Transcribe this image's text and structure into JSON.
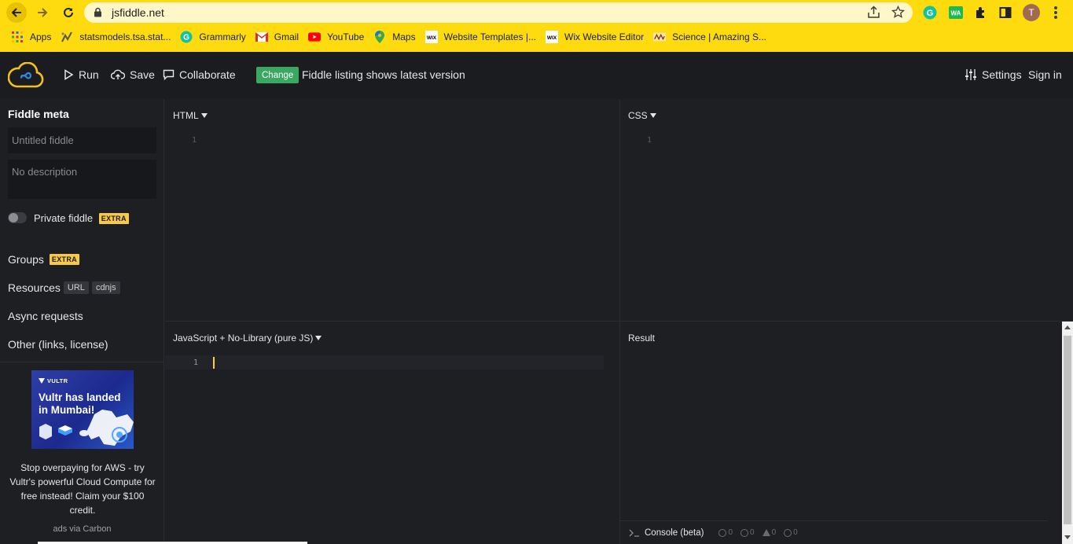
{
  "browser": {
    "url": "jsfiddle.net",
    "avatar_initial": "T",
    "bookmarks": [
      {
        "label": "Apps",
        "icon": "apps-grid-icon"
      },
      {
        "label": "statsmodels.tsa.stat...",
        "icon": "statsmodels-icon"
      },
      {
        "label": "Grammarly",
        "icon": "grammarly-icon"
      },
      {
        "label": "Gmail",
        "icon": "gmail-icon"
      },
      {
        "label": "YouTube",
        "icon": "youtube-icon"
      },
      {
        "label": "Maps",
        "icon": "maps-icon"
      },
      {
        "label": "Website Templates |...",
        "icon": "wix-icon"
      },
      {
        "label": "Wix Website Editor",
        "icon": "wix-icon"
      },
      {
        "label": "Science | Amazing S...",
        "icon": "science-icon"
      }
    ],
    "extension_wa": "WA"
  },
  "header": {
    "run_label": "Run",
    "save_label": "Save",
    "collaborate_label": "Collaborate",
    "change_label": "Change",
    "listing_text": "Fiddle listing shows latest version",
    "settings_label": "Settings",
    "signin_label": "Sign in"
  },
  "sidebar": {
    "meta_title": "Fiddle meta",
    "title_placeholder": "Untitled fiddle",
    "description_placeholder": "No description",
    "private_label": "Private fiddle",
    "extra_badge": "EXTRA",
    "groups_label": "Groups",
    "resources_label": "Resources",
    "resource_tags": [
      "URL",
      "cdnjs"
    ],
    "async_label": "Async requests",
    "other_label": "Other (links, license)",
    "ad": {
      "brand": "VULTR",
      "headline": "Vultr has landed in Mumbai!",
      "text": "Stop overpaying for AWS - try Vultr's powerful Cloud Compute for free instead! Claim your $100 credit.",
      "via": "ads via Carbon"
    }
  },
  "panels": {
    "html_title": "HTML",
    "css_title": "CSS",
    "js_title": "JavaScript + No-Library (pure JS)",
    "result_title": "Result",
    "line_number": "1"
  },
  "console": {
    "label": "Console (beta)",
    "info_count": "0",
    "log_count": "0",
    "warn_count": "0",
    "error_count": "0"
  },
  "colors": {
    "chrome_bg": "#fddb0e",
    "app_bg": "#1e1f23",
    "change_green": "#3aa861",
    "extra_yellow": "#f7c945",
    "cursor": "#f7d33a"
  }
}
